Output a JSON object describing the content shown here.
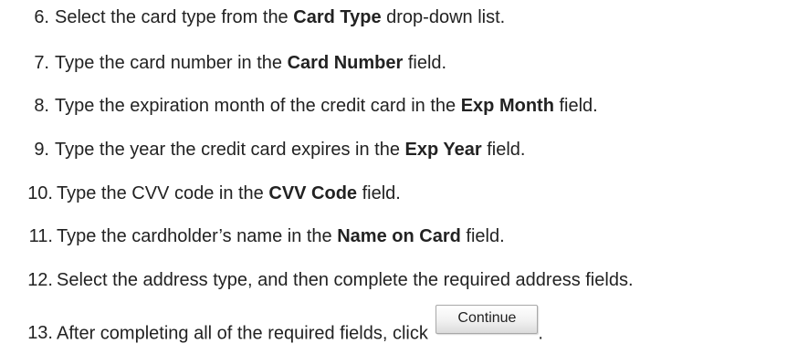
{
  "steps": [
    {
      "num": "6.",
      "pre": "Select the card type from the ",
      "bold": "Card Type",
      "post": " drop-down list."
    },
    {
      "num": "7.",
      "pre": "Type the card number in the ",
      "bold": "Card Number",
      "post": " field."
    },
    {
      "num": "8.",
      "pre": "Type the expiration month of the credit card in the ",
      "bold": "Exp Month",
      "post": " field."
    },
    {
      "num": "9.",
      "pre": "Type the year the credit card expires in the ",
      "bold": "Exp Year",
      "post": " field."
    },
    {
      "num": "10.",
      "pre": "Type the CVV code in the ",
      "bold": "CVV Code",
      "post": " field."
    },
    {
      "num": "11.",
      "pre": "Type the cardholder’s name in the ",
      "bold": "Name on Card",
      "post": " field."
    },
    {
      "num": "12.",
      "text": "Select the address type, and then complete the required address fields."
    },
    {
      "num": "13.",
      "pre": "After completing all of the required fields, click ",
      "post": "."
    }
  ],
  "continue_button": {
    "label": "Continue"
  }
}
